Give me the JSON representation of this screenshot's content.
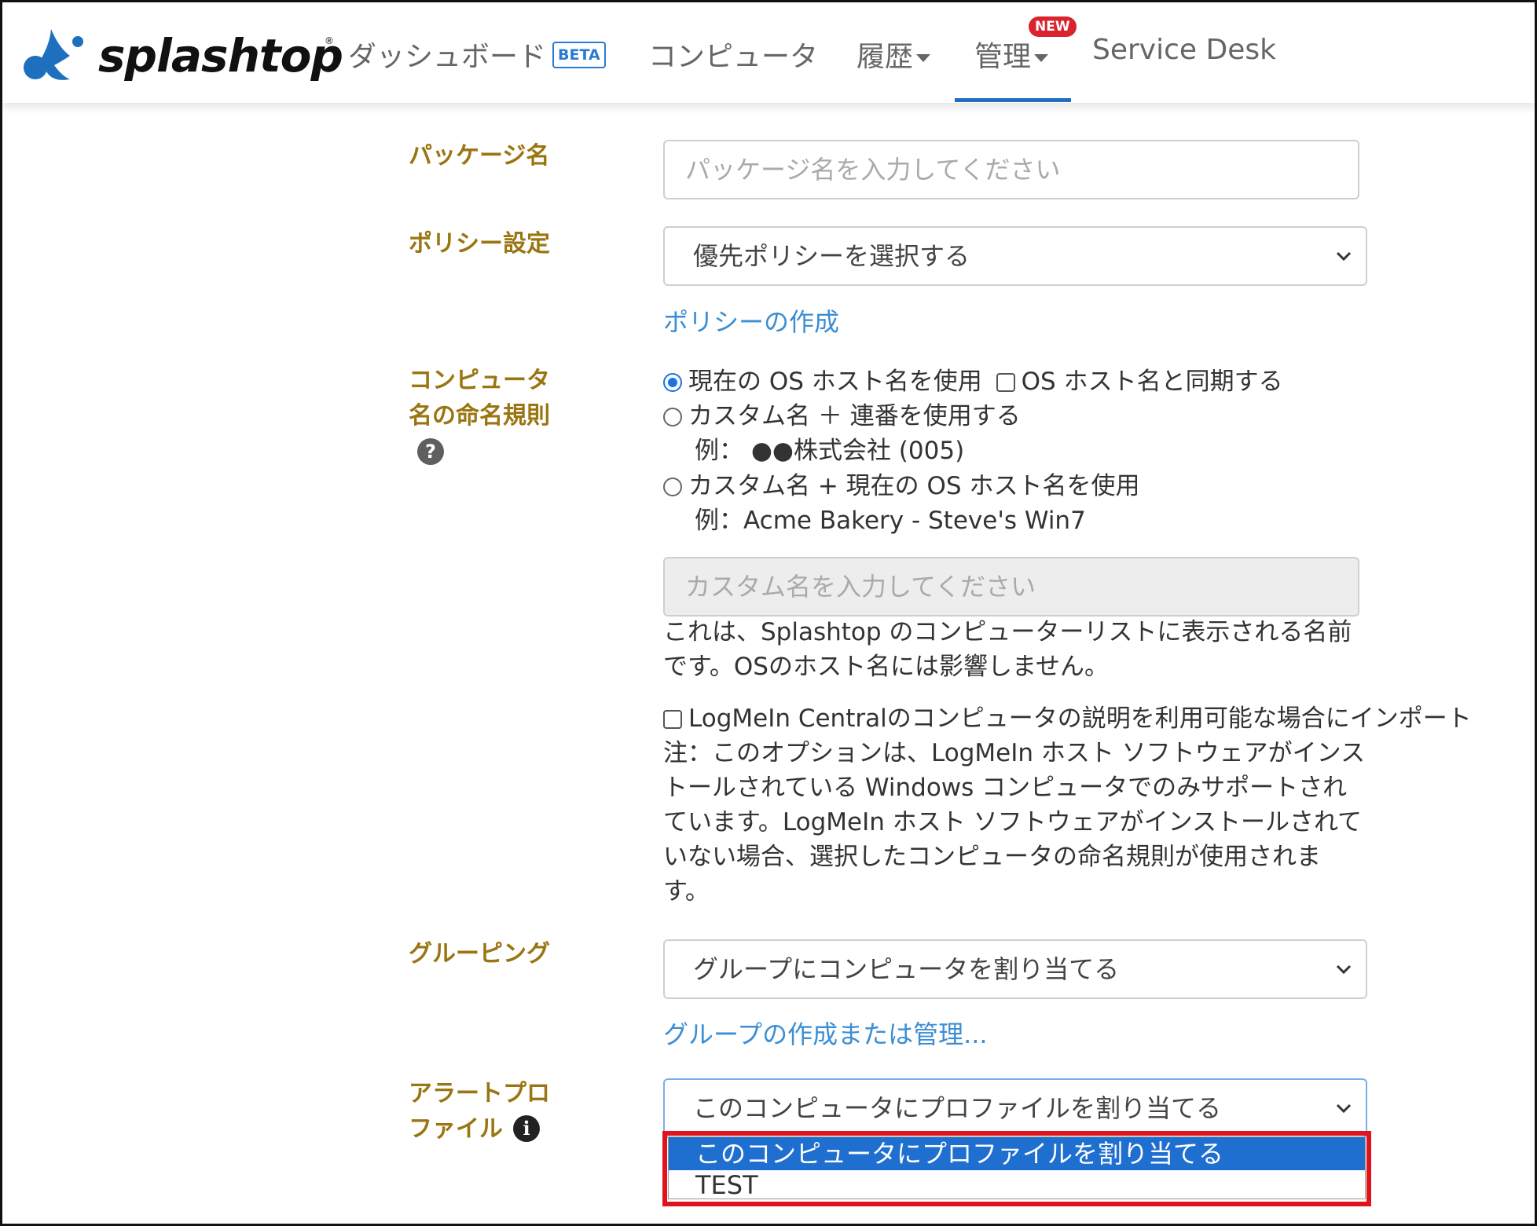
{
  "header": {
    "logo": "splashtop",
    "nav": {
      "dashboard": "ダッシュボード",
      "beta": "BETA",
      "computers": "コンピュータ",
      "history": "履歴",
      "admin": "管理",
      "new_badge": "NEW",
      "service_desk": "Service Desk"
    },
    "active_tab": "管理"
  },
  "form": {
    "package_name": {
      "label": "パッケージ名",
      "placeholder": "パッケージ名を入力してください"
    },
    "policy": {
      "label": "ポリシー設定",
      "selected": "優先ポリシーを選択する",
      "create_link": "ポリシーの作成"
    },
    "naming": {
      "label_line1": "コンピュータ",
      "label_line2": "名の命名規則",
      "help_icon": "?",
      "option1": "現在の OS ホスト名を使用",
      "sync_checkbox": "OS ホスト名と同期する",
      "option2": "カスタム名 ＋ 連番を使用する",
      "option2_example": "例：  ●●株式会社 (005)",
      "option3": "カスタム名 + 現在の OS ホスト名を使用",
      "option3_example": "例：Acme Bakery - Steve's Win7",
      "custom_placeholder": "カスタム名を入力してください",
      "note_line1": "これは、Splashtop のコンピューターリストに表示される名前",
      "note_line2": "です。OSのホスト名には影響しません。",
      "logmein_checkbox": "LogMeIn Centralのコンピュータの説明を利用可能な場合にインポート",
      "logmein_note": [
        "注：このオプションは、LogMeIn ホスト ソフトウェアがインス",
        "トールされている Windows コンピュータでのみサポートされ",
        "ています。LogMeIn ホスト ソフトウェアがインストールされて",
        "いない場合、選択したコンピュータの命名規則が使用されま",
        "す。"
      ]
    },
    "grouping": {
      "label": "グルーピング",
      "selected": "グループにコンピュータを割り当てる",
      "manage_link": "グループの作成または管理..."
    },
    "alert_profile": {
      "label_line1": "アラートプロ",
      "label_line2": "ファイル",
      "info_icon": "i",
      "selected": "このコンピュータにプロファイルを割り当てる",
      "options": [
        "このコンピュータにプロファイルを割り当てる",
        "TEST"
      ]
    }
  },
  "colors": {
    "label": "#9a7612",
    "link": "#3b8ed4",
    "selection": "#1f6fd1",
    "highlight": "#e0141e",
    "brand_blue": "#1f6fbf"
  }
}
